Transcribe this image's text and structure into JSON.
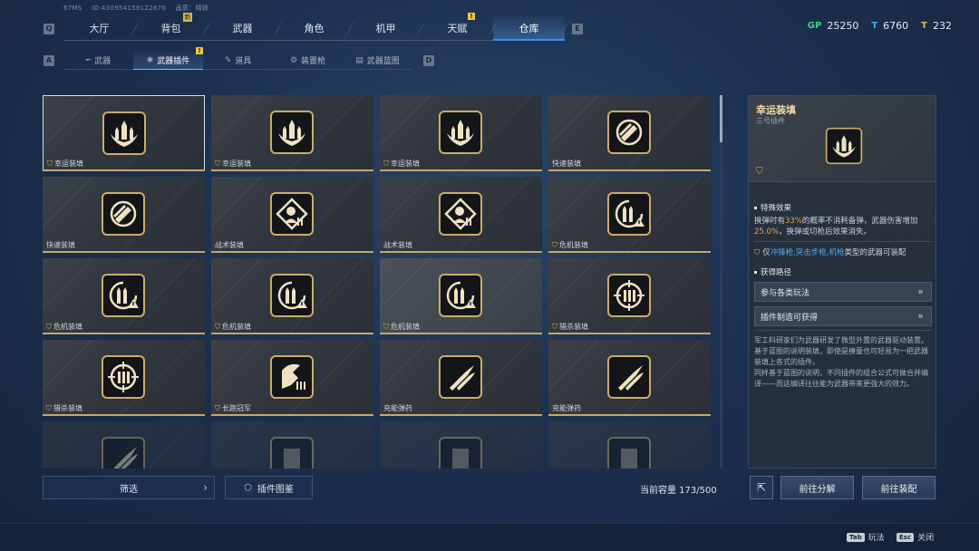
{
  "top_info": {
    "fps": "67MS",
    "uid": "ID:430954158122870",
    "quality": "画质：精致"
  },
  "top_tabs": {
    "key_left": "Q",
    "key_right": "E",
    "items": [
      {
        "label": "大厅",
        "badge": ""
      },
      {
        "label": "背包",
        "badge": "新"
      },
      {
        "label": "武器",
        "badge": ""
      },
      {
        "label": "角色",
        "badge": ""
      },
      {
        "label": "机甲",
        "badge": ""
      },
      {
        "label": "天赋",
        "badge": "!"
      },
      {
        "label": "仓库",
        "badge": "",
        "active": true
      }
    ]
  },
  "currencies": [
    {
      "icon": "gp-icon",
      "symbol": "GP",
      "value": "25250",
      "color": "#3fd08a"
    },
    {
      "icon": "ticket-icon",
      "symbol": "T",
      "value": "6760",
      "color": "#3fb3f0"
    },
    {
      "icon": "coin-icon",
      "symbol": "T",
      "value": "232",
      "color": "#e8b84a"
    }
  ],
  "sub_tabs": {
    "key_left": "A",
    "key_right": "D",
    "items": [
      {
        "label": "武器",
        "icon": "rifle-icon",
        "glyph": "╾"
      },
      {
        "label": "武器插件",
        "icon": "plugin-icon",
        "glyph": "✱",
        "active": true,
        "badge": "!"
      },
      {
        "label": "道具",
        "icon": "tool-icon",
        "glyph": "✎"
      },
      {
        "label": "装置枪",
        "icon": "device-gun-icon",
        "glyph": "⚙"
      },
      {
        "label": "武器蓝图",
        "icon": "blueprint-icon",
        "glyph": "▤"
      }
    ]
  },
  "plugins": [
    {
      "label": "幸运装填",
      "icon": "lucky-reload-icon",
      "shield": true,
      "selected": true
    },
    {
      "label": "幸运装填",
      "icon": "lucky-reload-icon",
      "shield": true
    },
    {
      "label": "幸运装填",
      "icon": "lucky-reload-icon",
      "shield": true
    },
    {
      "label": "快速装填",
      "icon": "quick-reload-icon",
      "shield": false
    },
    {
      "label": "快速装填",
      "icon": "quick-reload-icon",
      "shield": false
    },
    {
      "label": "战术装填",
      "icon": "tactical-reload-icon",
      "shield": false
    },
    {
      "label": "战术装填",
      "icon": "tactical-reload-icon",
      "shield": false
    },
    {
      "label": "危机装填",
      "icon": "crisis-reload-icon",
      "shield": true
    },
    {
      "label": "危机装填",
      "icon": "crisis-reload-icon",
      "shield": true
    },
    {
      "label": "危机装填",
      "icon": "crisis-reload-icon",
      "shield": true
    },
    {
      "label": "危机装填",
      "icon": "crisis-reload-icon",
      "shield": true,
      "highlight": true
    },
    {
      "label": "猎杀装填",
      "icon": "hunter-reload-icon",
      "shield": true
    },
    {
      "label": "猎杀装填",
      "icon": "hunter-reload-icon",
      "shield": true
    },
    {
      "label": "长跑冠军",
      "icon": "marathon-icon",
      "shield": true
    },
    {
      "label": "充能弹药",
      "icon": "charged-ammo-icon",
      "shield": false
    },
    {
      "label": "充能弹药",
      "icon": "charged-ammo-icon",
      "shield": false
    },
    {
      "label": "",
      "icon": "charged-ammo-icon",
      "shield": false,
      "fade": true
    },
    {
      "label": "",
      "icon": "plugin-icon",
      "shield": false,
      "fade": true
    },
    {
      "label": "",
      "icon": "plugin-icon",
      "shield": false,
      "fade": true
    },
    {
      "label": "",
      "icon": "plugin-icon",
      "shield": false,
      "fade": true
    }
  ],
  "bottom": {
    "filter_label": "筛选",
    "catalog_label": "插件图鉴",
    "capacity_text": "当前容量 173/500"
  },
  "detail": {
    "title": "幸运装填",
    "subtitle": "三号插件",
    "special_title": "特殊效果",
    "effect_pre": "换弹时有",
    "effect_pct1": "33%",
    "effect_mid": "的概率不消耗备弹，武器伤害增加",
    "effect_pct2": "25.0%",
    "effect_post": "，换弹或切枪后效果消失。",
    "equip_pre": "仅",
    "equip_types": "冲锋枪,突击步枪,机枪",
    "equip_post": "类型的武器可装配",
    "source_title": "获得路径",
    "routes": [
      "参与各类玩法",
      "插件制造可获得"
    ],
    "lore": "军工科研家们为武器研发了微型外置的武器驱动装置。\n基于蓝图的说明装填，即使是揍童也可轻易为一把武器装填上各式的插件。\n同样基于蓝图的说明，不同插件的组合公式可做合并编译——而这编译往往能为武器带来更强大的效力。"
  },
  "actions": {
    "decompose": "前往分解",
    "equip": "前往装配"
  },
  "footer": {
    "hints": [
      {
        "key": "Tab",
        "label": "玩法"
      },
      {
        "key": "Esc",
        "label": "关闭"
      }
    ]
  },
  "colors": {
    "gold": "#c4a969",
    "accent_blue": "#3b8ff0",
    "highlight_orange": "#e9a53d"
  }
}
